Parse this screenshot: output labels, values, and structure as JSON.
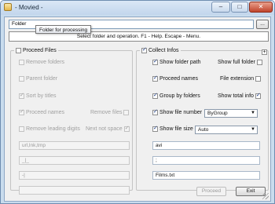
{
  "window": {
    "title": "- Movied -",
    "minimize": "–",
    "maximize": "□",
    "close": "✕"
  },
  "folder": {
    "value": "Folder",
    "tooltip": "Folder for processing",
    "browse_label": "..."
  },
  "help_bar": "Select folder and operation. F1 - Help. Escape - Menu.",
  "proceed_files": {
    "title": "Proceed Files",
    "remove_folders": "Remove folders",
    "parent_folder": "Parent folder",
    "sort_by_titles": "Sort by titles",
    "proceed_names": "Proceed names",
    "remove_files": "Remove files",
    "remove_leading_digits": "Remove leading digits",
    "next_not_space": "Next not space",
    "field1": "url,lnk,tmp",
    "field2": "_|_",
    "field3": "-|",
    "field4": ""
  },
  "collect_infos": {
    "title": "Collect Infos",
    "show_folder_path": "Show folder path",
    "show_full_folder": "Show full folder",
    "proceed_names": "Proceed names",
    "file_extension": "File extension",
    "group_by_folders": "Group by folders",
    "show_total_info": "Show total info",
    "show_file_number": "Show file number",
    "file_number_select": "ByGroup",
    "show_file_size": "Show file size",
    "file_size_select": "Auto",
    "field1": "avi",
    "field2": ";",
    "field3": "Films.txt",
    "plus": "+"
  },
  "buttons": {
    "proceed": "Proceed",
    "exit": "Exit"
  }
}
